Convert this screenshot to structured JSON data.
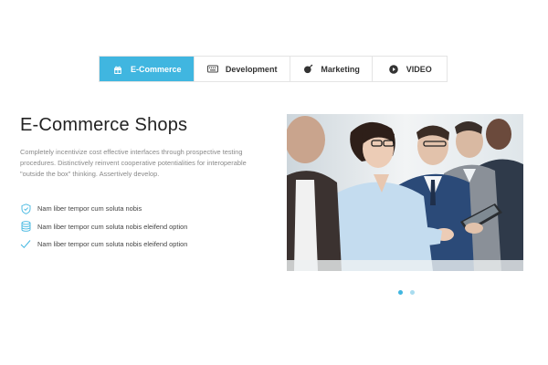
{
  "tabs": [
    {
      "label": "E-Commerce",
      "icon": "gift-icon",
      "active": true
    },
    {
      "label": "Development",
      "icon": "keyboard-icon",
      "active": false
    },
    {
      "label": "Marketing",
      "icon": "bomb-icon",
      "active": false
    },
    {
      "label": "VIDEO",
      "icon": "play-circle-icon",
      "active": false
    }
  ],
  "content": {
    "title": "E-Commerce Shops",
    "description": "Completely incentivize cost effective interfaces through prospective testing procedures. Distinctively reinvent cooperative potentialities for interoperable \"outside the box\" thinking. Assertively develop.",
    "features": [
      {
        "icon": "shield-icon",
        "text": "Nam liber tempor cum soluta nobis"
      },
      {
        "icon": "database-icon",
        "text": "Nam liber tempor cum soluta nobis eleifend option"
      },
      {
        "icon": "checkmark-icon",
        "text": "Nam liber tempor cum soluta nobis eleifend option"
      }
    ]
  },
  "carousel": {
    "slides": 2,
    "active_index": 0
  },
  "colors": {
    "accent": "#40b6e0",
    "dot_inactive": "#a9dcef"
  }
}
